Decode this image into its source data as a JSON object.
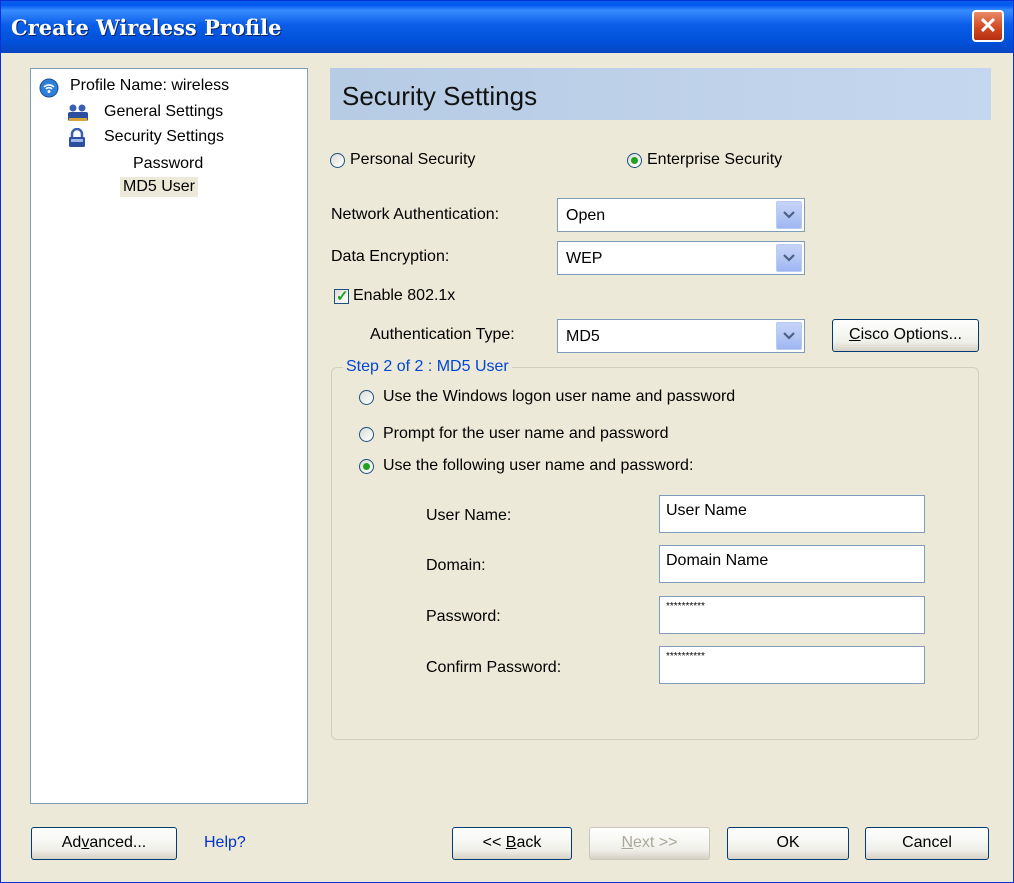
{
  "window": {
    "title": "Create Wireless Profile",
    "close_glyph": "✕"
  },
  "tree": {
    "profile_name": "Profile Name: wireless",
    "general_settings": "General Settings",
    "security_settings": "Security Settings",
    "password": "Password",
    "md5_user": "MD5 User"
  },
  "header": {
    "title": "Security Settings"
  },
  "security_mode": {
    "personal_label": "Personal Security",
    "enterprise_label": "Enterprise Security",
    "selected": "Enterprise Security"
  },
  "network_auth": {
    "label": "Network Authentication:",
    "value": "Open"
  },
  "data_encryption": {
    "label": "Data Encryption:",
    "value": "WEP"
  },
  "enable_8021x": {
    "label": "Enable 802.1x",
    "checked": true
  },
  "auth_type": {
    "label": "Authentication Type:",
    "value": "MD5"
  },
  "cisco_options": {
    "label_prefix": "C",
    "label_rest": "isco Options..."
  },
  "step_group": {
    "title": "Step 2 of 2 : MD5 User",
    "option1": "Use the Windows logon user name and password",
    "option2": "Prompt for the user name and password",
    "option3": "Use the following user name and password:",
    "selected": "Use the following user name and password:"
  },
  "credentials": {
    "user_name_label": "User Name:",
    "user_name_value": "User Name",
    "domain_label": "Domain:",
    "domain_value": "Domain Name",
    "password_label": "Password:",
    "password_value": "**********",
    "confirm_label": "Confirm Password:",
    "confirm_value": "**********"
  },
  "footer": {
    "advanced_pre": "Ad",
    "advanced_ul": "v",
    "advanced_post": "anced...",
    "help": "Help?",
    "back_pre": "<< ",
    "back_ul": "B",
    "back_post": "ack",
    "next_ul": "N",
    "next_post": "ext >>",
    "ok": "OK",
    "cancel": "Cancel"
  },
  "colors": {
    "title_bar": "#0a5ee8",
    "header_band": "#b6cbe4",
    "radio_dot": "#21a121",
    "group_title": "#0046d5",
    "help_link": "#0033cc"
  }
}
